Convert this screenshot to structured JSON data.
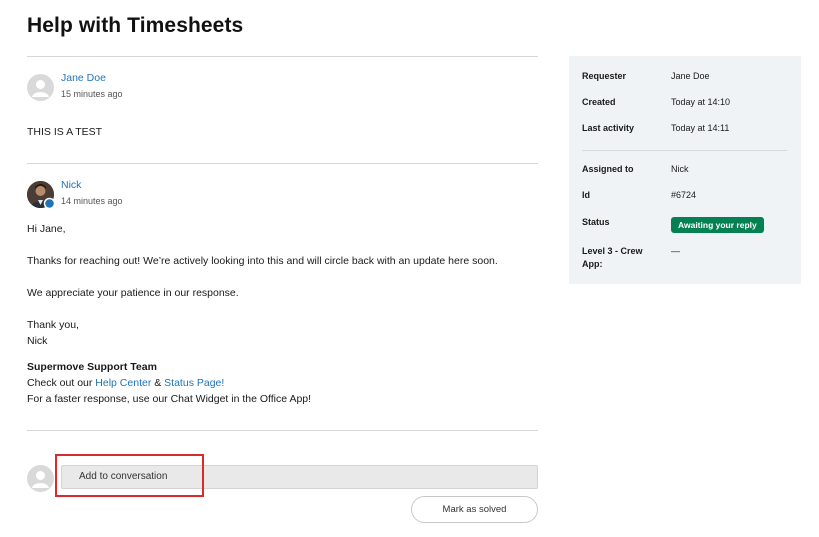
{
  "page": {
    "title": "Help with Timesheets"
  },
  "messages": [
    {
      "author": "Jane Doe",
      "time": "15 minutes ago",
      "body": [
        "THIS IS A TEST"
      ]
    },
    {
      "author": "Nick",
      "time": "14 minutes ago",
      "body": [
        "Hi Jane,",
        "Thanks for reaching out! We’re actively looking into this and will circle back with an update here soon.",
        "We appreciate your patience in our response.",
        "Thank you,",
        "Nick"
      ],
      "signature": {
        "team": "Supermove Support Team",
        "check_prefix": "Check out our ",
        "help_center": "Help Center",
        "amp": " & ",
        "status_page": "Status Page!",
        "faster": "For a faster response, use our Chat Widget in the Office App!"
      }
    }
  ],
  "sidebar": {
    "requester_label": "Requester",
    "requester_value": "Jane Doe",
    "created_label": "Created",
    "created_value": "Today at 14:10",
    "activity_label": "Last activity",
    "activity_value": "Today at 14:11",
    "assigned_label": "Assigned to",
    "assigned_value": "Nick",
    "id_label": "Id",
    "id_value": "#6724",
    "status_label": "Status",
    "status_value": "Awaiting your reply",
    "level_label_1": "Level 3 - Crew",
    "level_label_2": "App:",
    "level_value": "—"
  },
  "compose": {
    "placeholder": "Add to conversation"
  },
  "actions": {
    "mark_solved": "Mark as solved"
  },
  "colors": {
    "link": "#1f73b7",
    "status_badge": "#038153",
    "sidebar_bg": "#eff3f6",
    "highlight": "#d92b2b"
  }
}
